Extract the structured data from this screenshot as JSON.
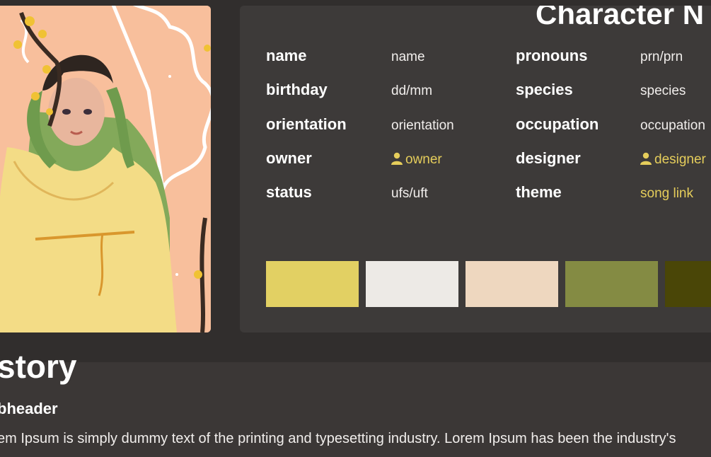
{
  "card": {
    "title": "Character N",
    "rows": [
      {
        "label_a": "name",
        "value_a": "name",
        "label_b": "pronouns",
        "value_b": "prn/prn"
      },
      {
        "label_a": "birthday",
        "value_a": "dd/mm",
        "label_b": "species",
        "value_b": "species"
      },
      {
        "label_a": "orientation",
        "value_a": "orientation",
        "label_b": "occupation",
        "value_b": "occupation"
      },
      {
        "label_a": "owner",
        "value_a": "owner",
        "label_b": "designer",
        "value_b": "designer"
      },
      {
        "label_a": "status",
        "value_a": "ufs/uft",
        "label_b": "theme",
        "value_b": "song link"
      }
    ],
    "owner_icon": "person-icon",
    "designer_icon": "person-icon"
  },
  "palette": [
    "#e2d063",
    "#edeae6",
    "#eed7bf",
    "#848b43",
    "#4a4607"
  ],
  "colors": {
    "accent": "#e5cd5b",
    "background": "#3b3736",
    "card": "#3d3a39"
  },
  "story": {
    "title": "story",
    "subheader": "bheader",
    "body": "em Ipsum is simply dummy text of the printing and typesetting industry. Lorem Ipsum has been the industry's"
  }
}
